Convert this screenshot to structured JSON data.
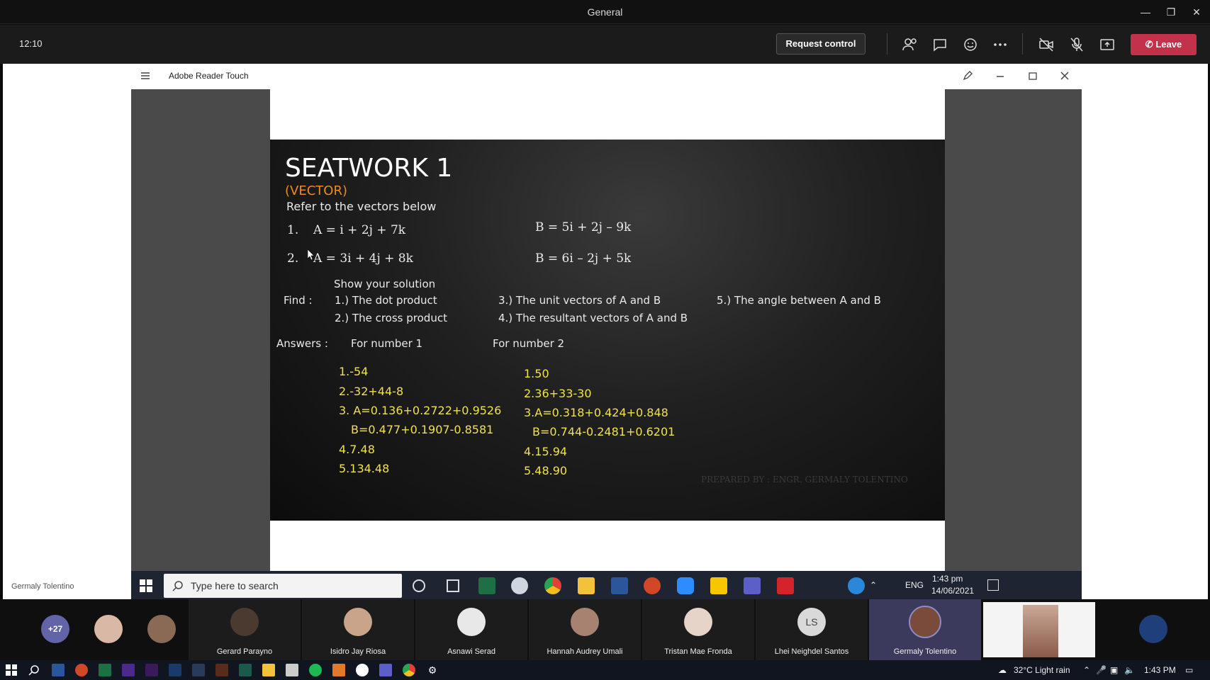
{
  "window": {
    "title": "General",
    "controls": [
      "minimize-icon",
      "restore-icon",
      "close-icon"
    ]
  },
  "meeting_toolbar": {
    "elapsed": "12:10",
    "request_control_label": "Request control",
    "icons": [
      "people-icon",
      "chat-icon",
      "reactions-icon",
      "more-icon",
      "camera-off-icon",
      "mic-off-icon",
      "share-icon"
    ],
    "leave_label": "Leave",
    "leave_color": "#c4314b"
  },
  "reader": {
    "app_title": "Adobe Reader Touch",
    "icons": [
      "menu-icon",
      "pen-icon",
      "minimize-icon",
      "restore-icon",
      "close-icon"
    ]
  },
  "slide": {
    "title": "SEATWORK 1",
    "subtitle": "(VECTOR)",
    "instruction": "Refer to the vectors below",
    "problems": [
      {
        "num": "1.",
        "a": "A = i + 2j + 7k",
        "b": "B = 5i + 2j – 9k"
      },
      {
        "num": "2.",
        "a": "A = 3i + 4j + 8k",
        "b": "B = 6i – 2j + 5k"
      }
    ],
    "show_solution": "Show your solution",
    "find_label": "Find :",
    "find_items": [
      "1.) The dot product",
      "2.) The cross product",
      "3.) The unit vectors of A and B",
      "4.) The resultant vectors of A and B",
      "5.) The angle between A and B"
    ],
    "answers_label": "Answers :",
    "answers_col1_header": "For number 1",
    "answers_col2_header": "For number 2",
    "answers_col1": [
      "1.-54",
      "2.-32+44-8",
      "3. A=0.136+0.2722+0.9526",
      "B=0.477+0.1907-0.8581",
      "4.7.48",
      "5.134.48"
    ],
    "answers_col2": [
      "1.50",
      "2.36+33-30",
      "3.A=0.318+0.424+0.848",
      "B=0.744-0.2481+0.6201",
      "4.15.94",
      "5.48.90"
    ],
    "footer": "PREPARED BY : ENGR. GERMALY TOLENTINO",
    "subtitle_color": "#f08a1c",
    "answer_color": "#f0e24a"
  },
  "presenter_label": "Germaly Tolentino",
  "inner_taskbar": {
    "search_placeholder": "Type here to search",
    "language": "ENG",
    "time": "1:43 pm",
    "date": "14/06/2021"
  },
  "participants": {
    "overflow_count": "+27",
    "people": [
      {
        "name": "Gerard Parayno",
        "muted": true
      },
      {
        "name": "Isidro Jay Riosa",
        "muted": true
      },
      {
        "name": "Asnawi Serad",
        "muted": true
      },
      {
        "name": "Hannah Audrey Umali",
        "muted": true
      },
      {
        "name": "Tristan Mae Fronda",
        "muted": true
      },
      {
        "name": "Lhei Neighdel Santos",
        "muted": true,
        "initials": "LS"
      },
      {
        "name": "Germaly Tolentino",
        "muted": false
      }
    ]
  },
  "os_taskbar": {
    "weather": "32°C  Light rain",
    "time": "1:43 PM"
  }
}
